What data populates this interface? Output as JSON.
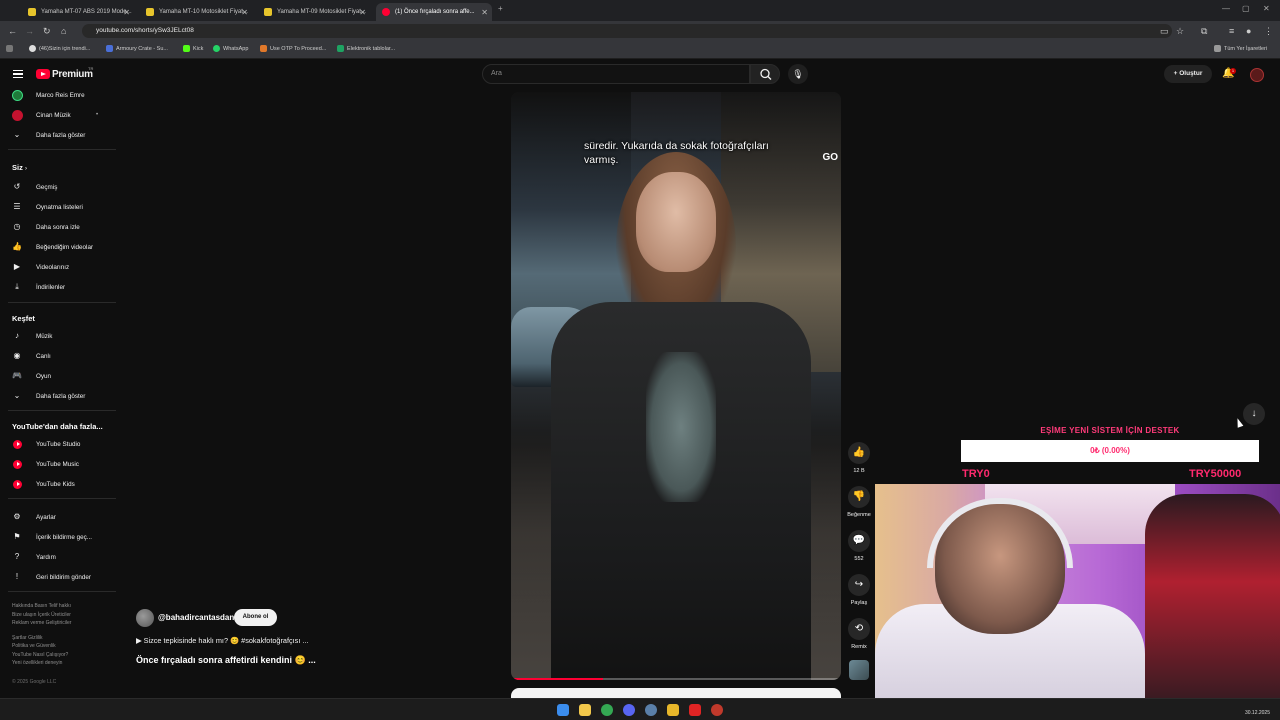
{
  "browser": {
    "tabs": [
      {
        "label": "Yamaha MT-07 ABS 2019 Mode...",
        "active": false
      },
      {
        "label": "Yamaha MT-10 Motosiklet Fiyat...",
        "active": false
      },
      {
        "label": "Yamaha MT-09 Motosiklet Fiyat...",
        "active": false
      },
      {
        "label": "(1) Önce fırçaladı sonra affe...",
        "active": true
      }
    ],
    "url": "youtube.com/shorts/ySw3JELct08",
    "bookmarks": [
      "(46)Sizin için trendi...",
      "Armoury Crate - Su...",
      "Kick",
      "WhatsApp",
      "Use OTP To Proceed...",
      "Elektronik tablolar..."
    ],
    "all_bookmarks": "Tüm Yer İşaretleri"
  },
  "header": {
    "brand": "Premium",
    "brand_tm": "TR",
    "search_placeholder": "Ara",
    "create_label": "Oluştur",
    "notification_count": "1"
  },
  "sidebar": {
    "subscriptions": [
      {
        "label": "Marco Reis Emre"
      },
      {
        "label": "Cinan Müzik"
      },
      {
        "label": "Daha fazla göster"
      }
    ],
    "you_heading": "Siz",
    "you_items": [
      {
        "label": "Geçmiş"
      },
      {
        "label": "Oynatma listeleri"
      },
      {
        "label": "Daha sonra izle"
      },
      {
        "label": "Beğendiğim videolar"
      },
      {
        "label": "Videolarınız"
      },
      {
        "label": "İndirilenler"
      }
    ],
    "explore_heading": "Keşfet",
    "explore_items": [
      {
        "label": "Müzik"
      },
      {
        "label": "Canlı"
      },
      {
        "label": "Oyun"
      },
      {
        "label": "Daha fazla göster"
      }
    ],
    "more_heading": "YouTube'dan daha fazla...",
    "more_items": [
      {
        "label": "YouTube Studio"
      },
      {
        "label": "YouTube Music"
      },
      {
        "label": "YouTube Kids"
      }
    ],
    "settings_items": [
      {
        "label": "Ayarlar"
      },
      {
        "label": "İçerik bildirme geç..."
      },
      {
        "label": "Yardım"
      },
      {
        "label": "Geri bildirim gönder"
      }
    ],
    "footer_lines": [
      "Hakkında   Basın   Telif hakkı",
      "Bize ulaşın   İçerik Üreticiler",
      "Reklam verme   Geliştiriciler",
      "",
      "Şartlar   Gizlilik",
      "Politika ve Güvenlik",
      "YouTube Nasıl Çalışıyor?",
      "Yeni özellikleri deneyin"
    ],
    "copyright": "© 2025 Google LLC"
  },
  "short": {
    "caption": "süredir. Yukarıda da sokak fotoğrafçıları varmış.",
    "overlay_logo": "GO",
    "progress_fraction": 0.28,
    "channel": "@bahadircantasdan",
    "subscribe_label": "Abone ol",
    "description": "▶ Sizce tepkisinde haklı mı? 😊 #sokakfotoğrafçısı ...",
    "title": "Önce fırçaladı sonra affetirdi kendini 😊 ..."
  },
  "actions": {
    "like_count": "12 B",
    "dislike_label": "Beğenme",
    "comment_count": "552",
    "share_label": "Paylaş",
    "remix_label": "Remix"
  },
  "donation": {
    "title": "EŞİME YENİ SİSTEM İÇİN DESTEK",
    "progress_text": "0₺ (0.00%)",
    "progress_fraction": 0.0,
    "min_label": "TRY0",
    "max_label": "TRY50000",
    "accent": "#ff2a6e"
  },
  "taskbar": {
    "clock": "30.12.2025"
  }
}
